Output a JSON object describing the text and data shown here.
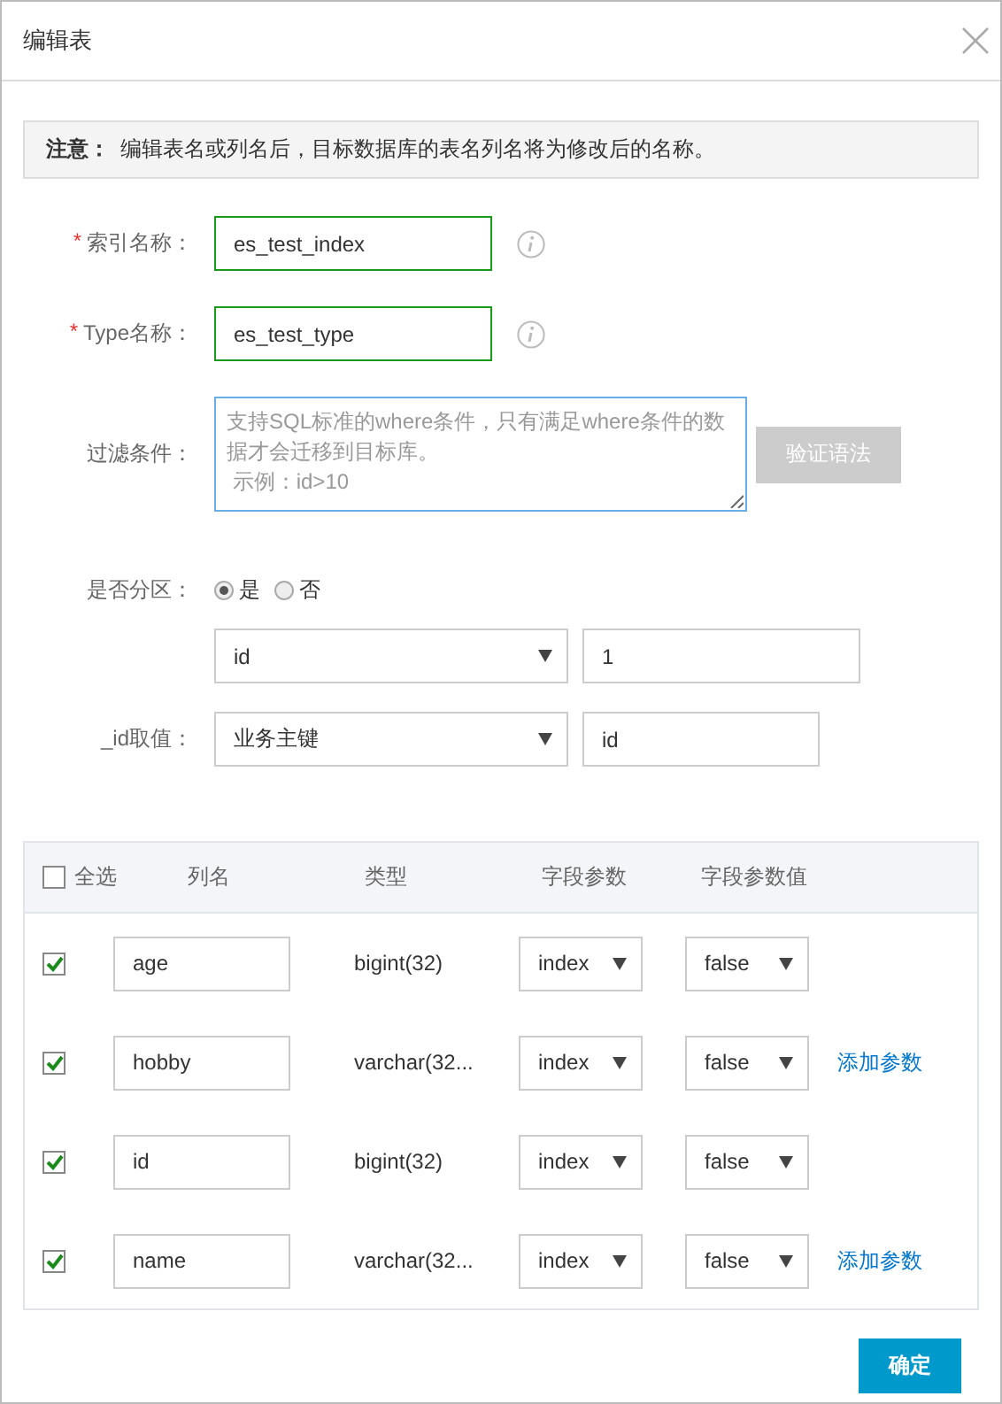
{
  "dialog": {
    "title": "编辑表"
  },
  "notice": {
    "label": "注意：",
    "text": "编辑表名或列名后，目标数据库的表名列名将为修改后的名称。"
  },
  "form": [
    {
      "kind": "text",
      "required_mark": "*",
      "label": "索引名称：",
      "value": "es_test_index"
    },
    {
      "kind": "text",
      "required_mark": "*",
      "label": "Type名称：",
      "value": "es_test_type"
    },
    {
      "kind": "textarea",
      "label": "过滤条件：",
      "placeholder": [
        "支持SQL标准的where条件，只有满足where条件的数据才会迁移到目标库。",
        "示例：id>10"
      ],
      "button": "验证语法",
      "button_disabled": true
    },
    {
      "kind": "radio",
      "label": "是否分区：",
      "options": [
        {
          "label": "是",
          "selected": true
        },
        {
          "label": "否",
          "selected": false
        }
      ]
    },
    {
      "kind": "select_input",
      "select": "id",
      "value": "1"
    },
    {
      "kind": "select_input",
      "label": "_id取值：",
      "select": "业务主键",
      "value": "id"
    }
  ],
  "table": {
    "select_all": {
      "label": "全选",
      "checked": false
    },
    "columns": [
      "列名",
      "类型",
      "字段参数",
      "字段参数值"
    ],
    "rows": [
      {
        "checked": true,
        "name": "age",
        "type": "bigint(32)",
        "param": "index",
        "param_value": "false"
      },
      {
        "checked": true,
        "name": "hobby",
        "type": "varchar(32...",
        "param": "index",
        "param_value": "false",
        "action": "添加参数"
      },
      {
        "checked": true,
        "name": "id",
        "type": "bigint(32)",
        "param": "index",
        "param_value": "false"
      },
      {
        "checked": true,
        "name": "name",
        "type": "varchar(32...",
        "param": "index",
        "param_value": "false",
        "action": "添加参数"
      }
    ]
  },
  "footer": {
    "button": "确定"
  }
}
